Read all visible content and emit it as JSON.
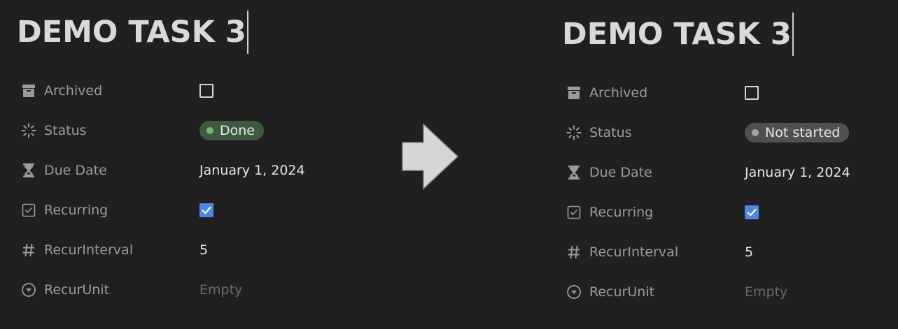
{
  "colors": {
    "background": "#202020",
    "done_pill_bg": "#3d5a3f",
    "done_dot": "#6fb873",
    "not_started_pill_bg": "#505050",
    "not_started_dot": "#a5a5a5",
    "checkbox_checked": "#4f86e6"
  },
  "before": {
    "title": "DEMO TASK 3",
    "archived_label": "Archived",
    "status_label": "Status",
    "status_value": "Done",
    "due_date_label": "Due Date",
    "due_date_value": "January 1, 2024",
    "recurring_label": "Recurring",
    "recur_interval_label": "RecurInterval",
    "recur_interval_value": "5",
    "recur_unit_label": "RecurUnit",
    "recur_unit_value": "Empty",
    "archived_checked": false,
    "recurring_checked": true
  },
  "after": {
    "title": "DEMO TASK 3",
    "archived_label": "Archived",
    "status_label": "Status",
    "status_value": "Not started",
    "due_date_label": "Due Date",
    "due_date_value": "January 1, 2024",
    "recurring_label": "Recurring",
    "recur_interval_label": "RecurInterval",
    "recur_interval_value": "5",
    "recur_unit_label": "RecurUnit",
    "recur_unit_value": "Empty",
    "archived_checked": false,
    "recurring_checked": true
  },
  "icons": {
    "archived": "archive-box-icon",
    "status": "loading-spinner-icon",
    "due_date": "hourglass-icon",
    "recurring": "checkbox-property-icon",
    "recur_interval": "hash-icon",
    "recur_unit": "select-circle-chevron-icon",
    "transition": "right-arrow-icon"
  }
}
